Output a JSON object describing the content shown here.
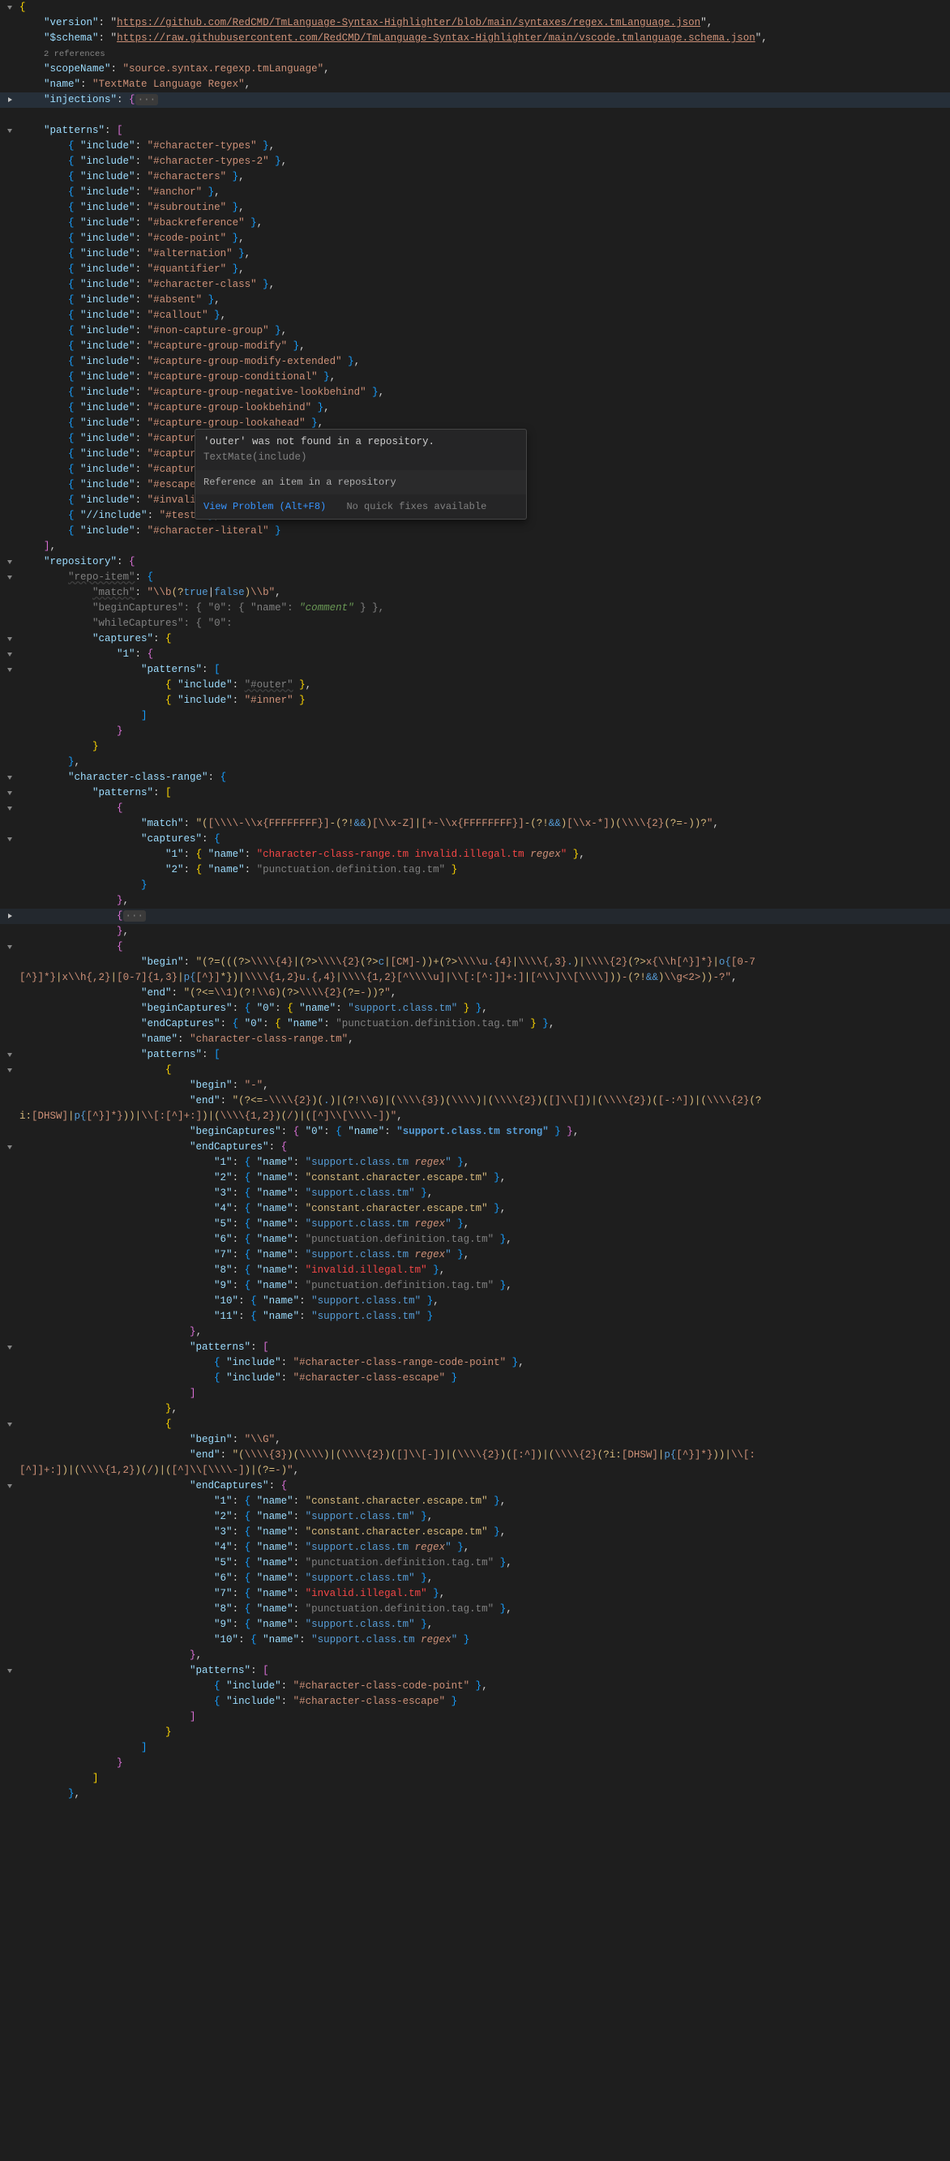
{
  "header": {
    "version_label": "\"version\"",
    "version_url": "https://github.com/RedCMD/TmLanguage-Syntax-Highlighter/blob/main/syntaxes/regex.tmLanguage.json",
    "schema_label": "\"$schema\"",
    "schema_url": "https://raw.githubusercontent.com/RedCMD/TmLanguage-Syntax-Highlighter/main/vscode.tmlanguage.schema.json",
    "refs": "2 references",
    "scope_name_label": "\"scopeName\"",
    "scope_name_value": "\"source.syntax.regexp.tmLanguage\"",
    "name_label": "\"name\"",
    "name_value": "\"TextMate Language Regex\"",
    "injections_label": "\"injections\""
  },
  "patterns_label": "\"patterns\"",
  "includes": [
    "#character-types",
    "#character-types-2",
    "#characters",
    "#anchor",
    "#subroutine",
    "#backreference",
    "#code-point",
    "#alternation",
    "#quantifier",
    "#character-class",
    "#absent",
    "#callout",
    "#non-capture-group",
    "#capture-group-modify",
    "#capture-group-modify-extended",
    "#capture-group-conditional",
    "#capture-group-negative-lookbehind",
    "#capture-group-lookbehind",
    "#capture-group-lookahead",
    "#capture-group-comment",
    "#capture-group-name",
    "#capture-group",
    "#escape-character",
    "#invalid"
  ],
  "include_label": "\"include\"",
  "slash_include_label": "\"//include\"",
  "test_value": "\"#test\"",
  "character_literal_value": "\"#character-literal\"",
  "repository_label": "\"repository\"",
  "repo": {
    "item_label": "\"repo-item\"",
    "match_label": "\"match\"",
    "match_parts": [
      "\"\\\\b",
      "(?",
      "true",
      "|",
      "false",
      ")",
      "\\\\b\""
    ],
    "beginCaptures_label": "\"beginCaptures\"",
    "whileCaptures_label": "\"whileCaptures\"",
    "captures_label": "\"captures\"",
    "zero_key": "\"0\"",
    "one_key": "\"1\"",
    "name_key": "\"name\"",
    "comment_scope": "\"comment\"",
    "patterns_key": "\"patterns\"",
    "outer_value": "\"#outer\"",
    "inner_value": "\"#inner\""
  },
  "hover": {
    "msg_pre": "'outer' was not found in a repository.",
    "msg_dim": "TextMate(include)",
    "desc": "Reference an item in a repository",
    "view_problem": "View Problem (Alt+F8)",
    "no_fix": "No quick fixes available"
  },
  "char_class_range": {
    "label": "\"character-class-range\"",
    "match1": "\"([\\\\\\\\-\\\\x{FFFFFFFF}]-(?!&&)[\\\\x-Z]|[+-\\\\x{FFFFFFFF}]-(?!&&)[\\\\x-*])(\\\\\\\\{2}(?=-))?\"",
    "cap1_name": "\"character-class-range.tm invalid.illegal.tm regex\"",
    "cap2_name": "\"punctuation.definition.tag.tm\""
  },
  "block2": {
    "begin": "\"(?=(((?>\\\\\\\\{4}|(?>\\\\\\\\{2}(?>c|[CM]-))+(?>\\\\\\\\u.{4}|\\\\\\\\{,3}.)|\\\\\\\\{2}(?>x{\\\\h[^}]*}|o{[0-7[^}]*}|x\\\\h{,2}|[0-7]{1,3}|p{[^}]*})|\\\\\\\\{1,2}u.{,4}|\\\\\\\\{1,2}[^\\\\\\\\u]|\\\\[:[^:]]+:]|[^\\\\]\\\\[\\\\\\\\]))-(?!&&)\\\\g<2>))-?\"",
    "end": "\"(?<=\\\\1)(?!\\\\G)(?>\\\\\\\\{2}(?=-))?\"",
    "beginCap_name": "\"support.class.tm\"",
    "endCap_name": "\"punctuation.definition.tag.tm\"",
    "name_value": "\"character-class-range.tm\"",
    "inner_begin": "\"-\"",
    "inner_end": "\"(?<=-\\\\\\\\{2})(.)|(?!\\\\G)|(\\\\\\\\{3})(\\\\\\\\)|(\\\\\\\\{2})([]\\\\[])|(\\\\\\\\{2})([-:^])|(\\\\\\\\{2}(?i:[DHSW]|p{[^}]*}))|\\\\[:[^]+:])|(\\\\\\\\{1,2})(/)|([^]\\\\[\\\\\\\\-])\"",
    "inner_beginCap": "\"support.class.tm strong\"",
    "endCaptures": [
      "\"support.class.tm regex\"",
      "\"constant.character.escape.tm\"",
      "\"support.class.tm\"",
      "\"constant.character.escape.tm\"",
      "\"support.class.tm regex\"",
      "\"punctuation.definition.tag.tm\"",
      "\"support.class.tm regex\"",
      "\"invalid.illegal.tm\"",
      "\"punctuation.definition.tag.tm\"",
      "\"support.class.tm\"",
      "\"support.class.tm\""
    ],
    "inc1": "\"#character-class-range-code-point\"",
    "inc2": "\"#character-class-escape\""
  },
  "block3": {
    "begin": "\"\\\\G\"",
    "end": "\"(\\\\\\\\{3})(\\\\\\\\)|(\\\\\\\\{2})([]\\\\[-])|(\\\\\\\\{2})([:^])|(\\\\\\\\{2}(?i:[DHSW]|p{[^}]*}))|\\\\[:[^]]+:])|(\\\\\\\\{1,2})(/)|([^]\\\\[\\\\\\\\-])|(?=-)\"",
    "endCaptures": [
      "\"constant.character.escape.tm\"",
      "\"support.class.tm\"",
      "\"constant.character.escape.tm\"",
      "\"support.class.tm regex\"",
      "\"punctuation.definition.tag.tm\"",
      "\"support.class.tm\"",
      "\"invalid.illegal.tm\"",
      "\"punctuation.definition.tag.tm\"",
      "\"support.class.tm\"",
      "\"support.class.tm regex\""
    ],
    "inc1": "\"#character-class-code-point\"",
    "inc2": "\"#character-class-escape\""
  },
  "keys": {
    "match": "\"match\"",
    "captures": "\"captures\"",
    "name": "\"name\"",
    "begin": "\"begin\"",
    "end": "\"end\"",
    "beginCaptures": "\"beginCaptures\"",
    "endCaptures": "\"endCaptures\"",
    "patterns": "\"patterns\"",
    "include": "\"include\"",
    "k1": "\"1\"",
    "k2": "\"2\"",
    "k3": "\"3\"",
    "k4": "\"4\"",
    "k5": "\"5\"",
    "k6": "\"6\"",
    "k7": "\"7\"",
    "k8": "\"8\"",
    "k9": "\"9\"",
    "k10": "\"10\"",
    "k11": "\"11\"",
    "k0": "\"0\""
  }
}
